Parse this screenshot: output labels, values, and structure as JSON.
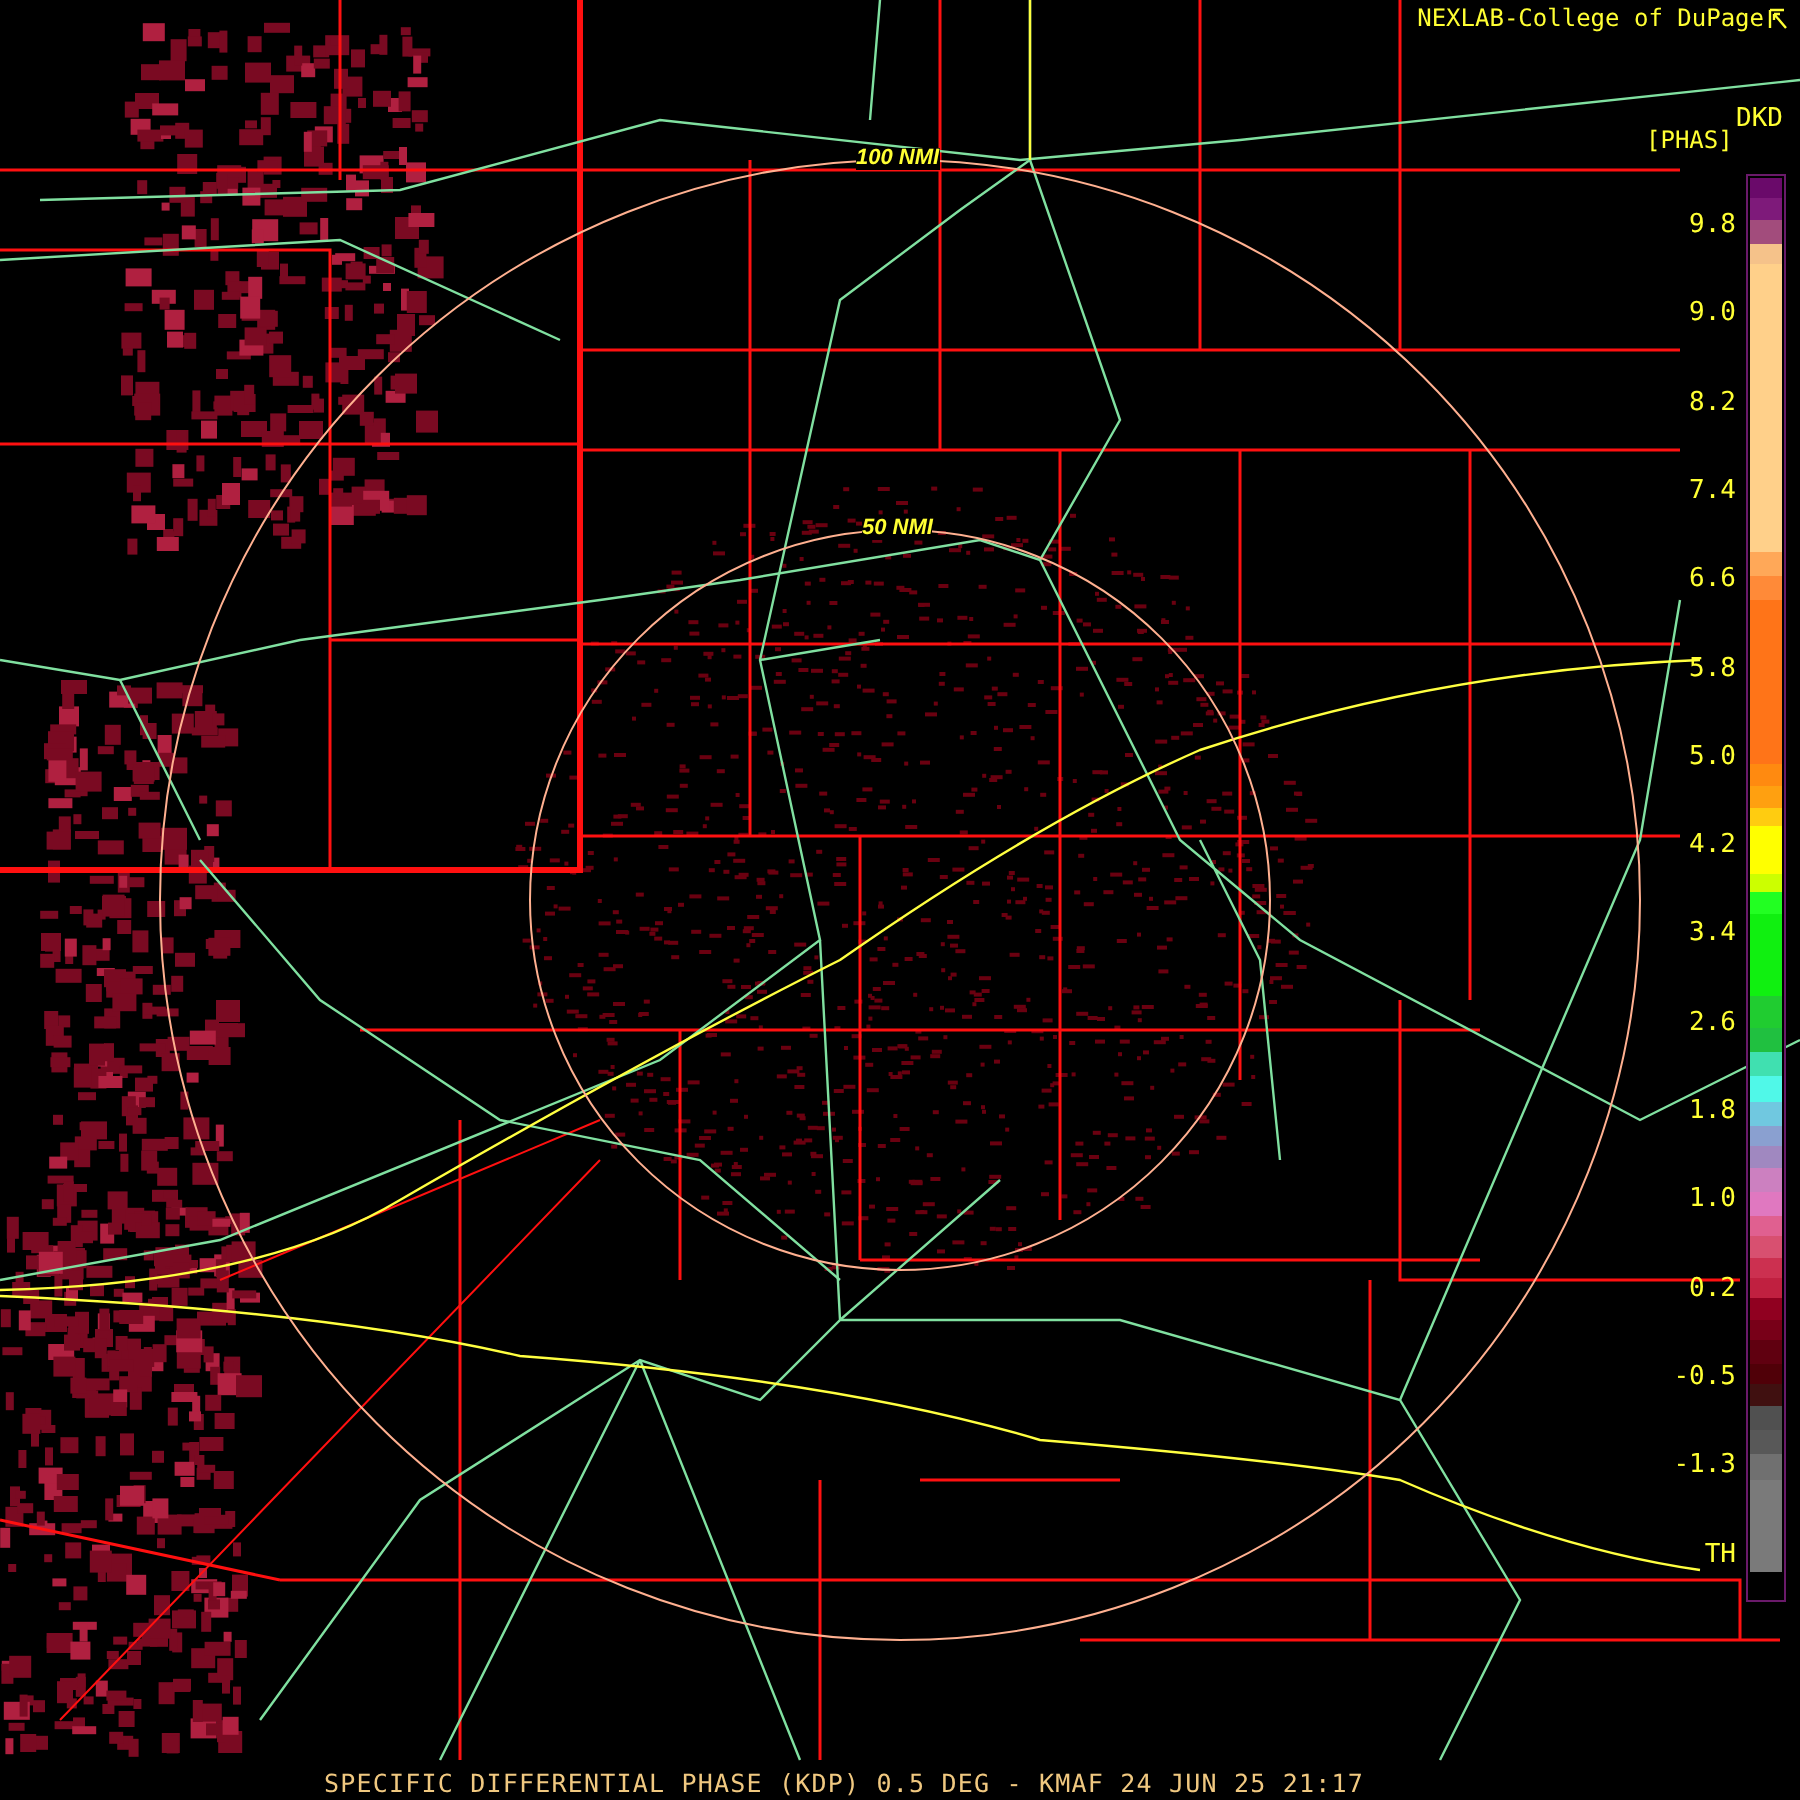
{
  "header": {
    "credit": "NEXLAB-College of DuPage"
  },
  "legend": {
    "unit": "DKD",
    "label": "[PHAS]",
    "ticks": [
      "9.8",
      "9.0",
      "8.2",
      "7.4",
      "6.6",
      "5.8",
      "5.0",
      "4.2",
      "3.4",
      "2.6",
      "1.8",
      "1.0",
      "0.2",
      "-0.5",
      "-1.3",
      "TH"
    ]
  },
  "range_rings": [
    {
      "label": "100 NMI"
    },
    {
      "label": "50 NMI"
    }
  ],
  "footer": {
    "caption": "SPECIFIC DIFFERENTIAL PHASE (KDP) 0.5 DEG - KMAF 24 JUN 25 21:17"
  }
}
